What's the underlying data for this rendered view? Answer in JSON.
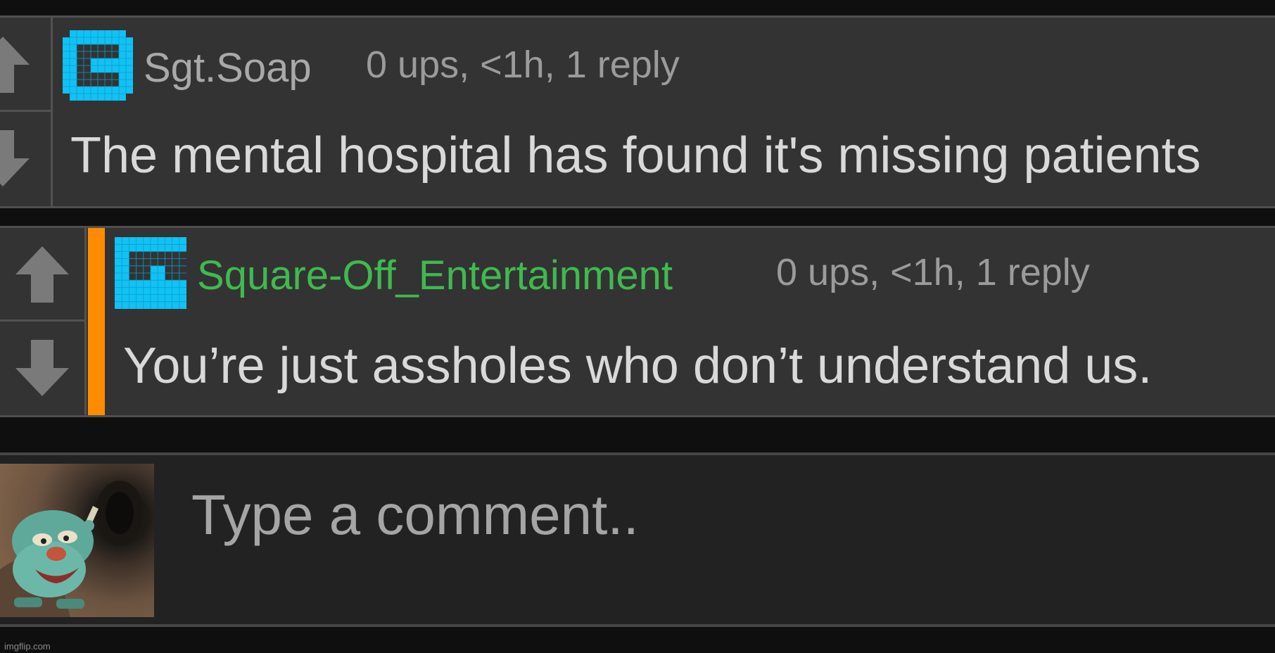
{
  "comments": [
    {
      "username": "Sgt.Soap",
      "meta": "0 ups, <1h, 1 reply",
      "text": "The mental hospital has found it's missing patients",
      "username_color": "#a9a9a9",
      "avatar_icon": "blue-pixel-logo-icon"
    },
    {
      "username": "Square-Off_Entertainment",
      "meta": "0 ups, <1h, 1 reply",
      "text": "You’re just assholes who don’t understand us.",
      "username_color": "#3fba4f",
      "avatar_icon": "blue-pixel-logo-icon",
      "reply_bar_color": "#ff8c00"
    }
  ],
  "composer": {
    "placeholder": "Type a comment.."
  },
  "watermark": "imgflip.com",
  "colors": {
    "background": "#0f0f0f",
    "comment_bg": "#333333",
    "avatar_blue": "#11c2f4"
  }
}
